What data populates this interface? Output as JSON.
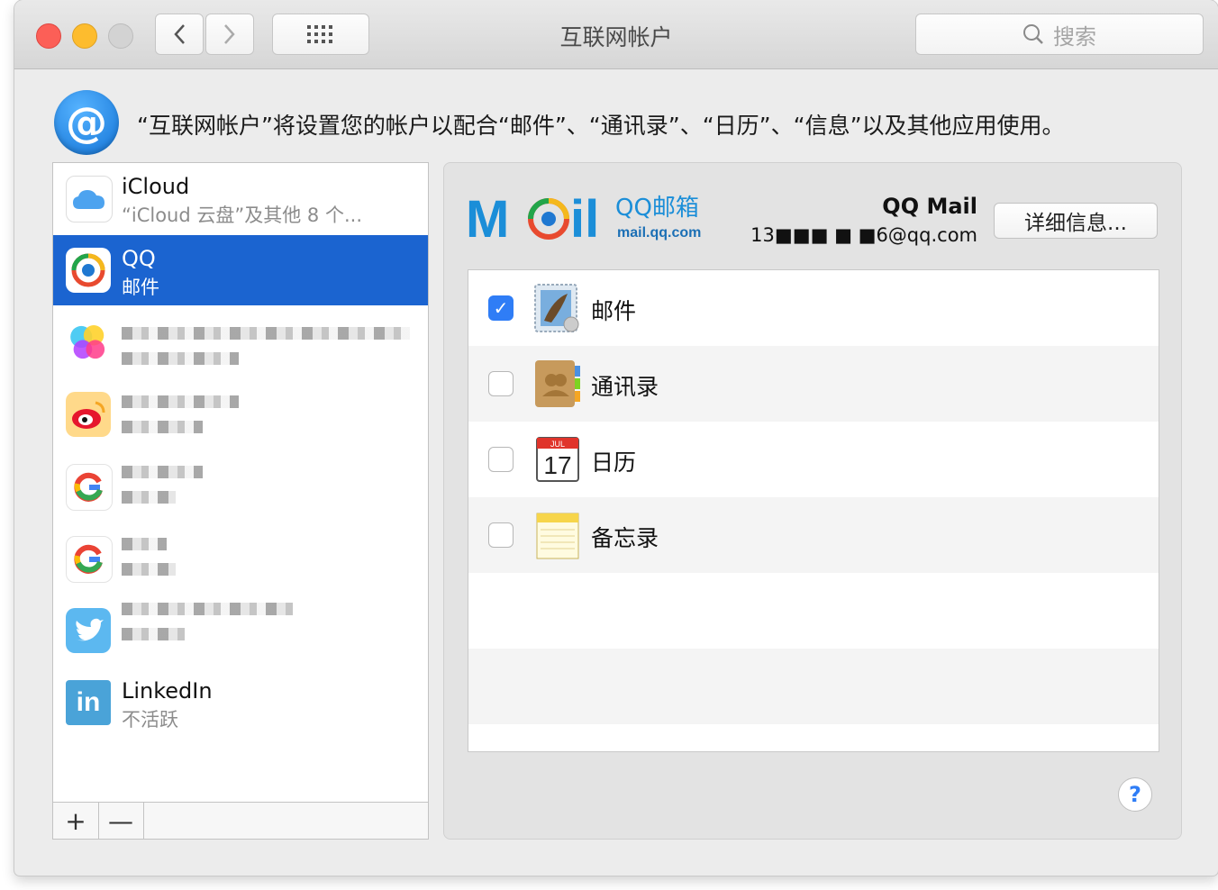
{
  "window": {
    "title": "互联网帐户"
  },
  "toolbar": {
    "search_placeholder": "搜索"
  },
  "header": {
    "description": "“互联网帐户”将设置您的帐户以配合“邮件”、“通讯录”、“日历”、“信息”以及其他应用使用。"
  },
  "accounts": [
    {
      "name": "iCloud",
      "subtitle": "“iCloud 云盘”及其他 8 个...",
      "icon": "icloud-icon",
      "selected": false
    },
    {
      "name": "QQ",
      "subtitle": "邮件",
      "icon": "qq-mail-icon",
      "selected": true
    },
    {
      "name": "",
      "subtitle": "",
      "icon": "game-center-icon",
      "selected": false
    },
    {
      "name": "",
      "subtitle": "",
      "icon": "weibo-icon",
      "selected": false
    },
    {
      "name": "",
      "subtitle": "",
      "icon": "google-icon",
      "selected": false
    },
    {
      "name": "",
      "subtitle": "",
      "icon": "google-icon",
      "selected": false
    },
    {
      "name": "",
      "subtitle": "",
      "icon": "twitter-icon",
      "selected": false
    },
    {
      "name": "LinkedIn",
      "subtitle": "不活跃",
      "icon": "linkedin-icon",
      "selected": false
    }
  ],
  "sidebar_footer": {
    "add_label": "+",
    "remove_label": "—"
  },
  "detail": {
    "logo_text": "QQ邮箱",
    "logo_url": "mail.qq.com",
    "account_title": "QQ Mail",
    "account_email": "13■■■ ■ ■6@qq.com",
    "details_button": "详细信息...",
    "services": [
      {
        "label": "邮件",
        "checked": true,
        "icon": "mail-app-icon"
      },
      {
        "label": "通讯录",
        "checked": false,
        "icon": "contacts-app-icon"
      },
      {
        "label": "日历",
        "checked": false,
        "icon": "calendar-app-icon",
        "calendar_month": "JUL",
        "calendar_day": "17"
      },
      {
        "label": "备忘录",
        "checked": false,
        "icon": "notes-app-icon"
      }
    ],
    "help_label": "?"
  }
}
